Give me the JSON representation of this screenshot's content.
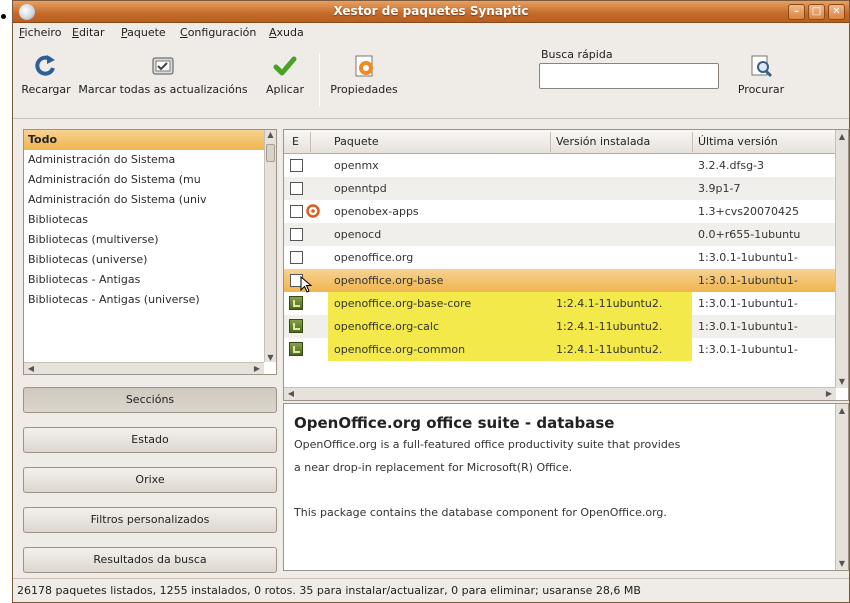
{
  "window": {
    "title": "Xestor de paquetes Synaptic",
    "controls": {
      "minimize": "–",
      "maximize": "□",
      "close": "✕"
    }
  },
  "menu": [
    "Ficheiro",
    "Editar",
    "Paquete",
    "Configuración",
    "Axuda"
  ],
  "toolbar": {
    "reload": "Recargar",
    "mark_all": "Marcar todas as actualizacións",
    "apply": "Aplicar",
    "properties": "Propiedades",
    "quick_search_label": "Busca rápida",
    "quick_search_value": "",
    "search": "Procurar"
  },
  "sections": {
    "items": [
      "Todo",
      "Administración do Sistema",
      "Administración do Sistema (mu",
      "Administración do Sistema (univ",
      "Bibliotecas",
      "Bibliotecas (multiverse)",
      "Bibliotecas (universe)",
      "Bibliotecas - Antigas",
      "Bibliotecas - Antigas (universe)"
    ],
    "selected_index": 0
  },
  "filter_buttons": {
    "sections": "Seccións",
    "status": "Estado",
    "origin": "Orixe",
    "custom_filters": "Filtros personalizados",
    "search_results": "Resultados da busca"
  },
  "table": {
    "columns": {
      "status": "E",
      "package": "Paquete",
      "installed": "Versión instalada",
      "latest": "Última versión"
    },
    "rows": [
      {
        "name": "openmx",
        "installed": "",
        "latest": "3.2.4.dfsg-3",
        "state": "none"
      },
      {
        "name": "openntpd",
        "installed": "",
        "latest": "3.9p1-7",
        "state": "none"
      },
      {
        "name": "openobex-apps",
        "installed": "",
        "latest": "1.3+cvs20070425",
        "state": "supported"
      },
      {
        "name": "openocd",
        "installed": "",
        "latest": "0.0+r655-1ubuntu",
        "state": "none"
      },
      {
        "name": "openoffice.org",
        "installed": "",
        "latest": "1:3.0.1-1ubuntu1-",
        "state": "none"
      },
      {
        "name": "openoffice.org-base",
        "installed": "",
        "latest": "1:3.0.1-1ubuntu1-",
        "state": "selected"
      },
      {
        "name": "openoffice.org-base-core",
        "installed": "1:2.4.1-11ubuntu2.",
        "latest": "1:3.0.1-1ubuntu1-",
        "state": "upgradable"
      },
      {
        "name": "openoffice.org-calc",
        "installed": "1:2.4.1-11ubuntu2.",
        "latest": "1:3.0.1-1ubuntu1-",
        "state": "upgradable"
      },
      {
        "name": "openoffice.org-common",
        "installed": "1:2.4.1-11ubuntu2.",
        "latest": "1:3.0.1-1ubuntu1-",
        "state": "upgradable"
      }
    ]
  },
  "description": {
    "title": "OpenOffice.org office suite - database",
    "line1": "OpenOffice.org is a full-featured office productivity suite that provides",
    "line2": "a near drop-in replacement for Microsoft(R) Office.",
    "line3": "This package contains the database component for OpenOffice.org."
  },
  "status": "26178 paquetes listados, 1255 instalados, 0 rotos. 35 para instalar/actualizar, 0 para eliminar; usaranse 28,6 MB",
  "colors": {
    "title_bar": "#c46a2a",
    "selection": "#efb54f",
    "upgradable_highlight": "#f4e94a"
  },
  "icons": [
    "reload-icon",
    "mark-all-icon",
    "apply-icon",
    "properties-icon",
    "search-icon"
  ]
}
